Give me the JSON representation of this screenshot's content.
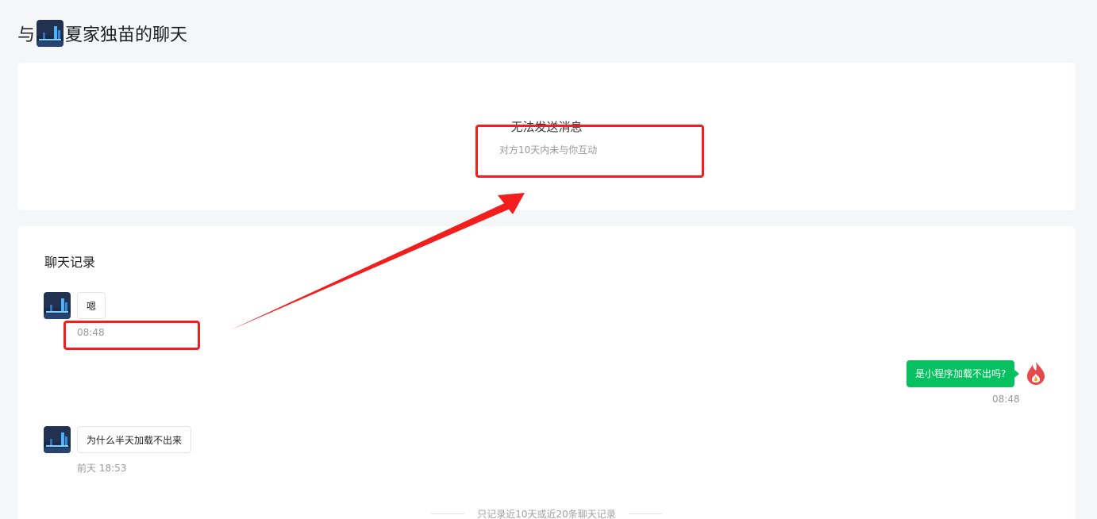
{
  "header": {
    "prefix": "与",
    "contact_name": "夏家独苗的聊天"
  },
  "notice": {
    "title": "无法发送消息",
    "subtitle": "对方10天内未与你互动"
  },
  "history": {
    "title": "聊天记录",
    "messages": [
      {
        "side": "left",
        "text": "嗯",
        "time": "08:48"
      },
      {
        "side": "right",
        "text": "是小程序加载不出吗?",
        "time": "08:48"
      },
      {
        "side": "left",
        "text": "为什么半天加载不出来",
        "time": "前天 18:53"
      }
    ],
    "footer_note": "只记录近10天或近20条聊天记录"
  },
  "colors": {
    "page_bg": "#f5f6f8",
    "card_bg": "#ffffff",
    "accent_green": "#07c160",
    "annotation_red": "#f21d1d",
    "logo_red": "#e5484d"
  },
  "icons": {
    "contact_avatar": "city-night-avatar",
    "self_avatar": "flame-logo-avatar"
  }
}
